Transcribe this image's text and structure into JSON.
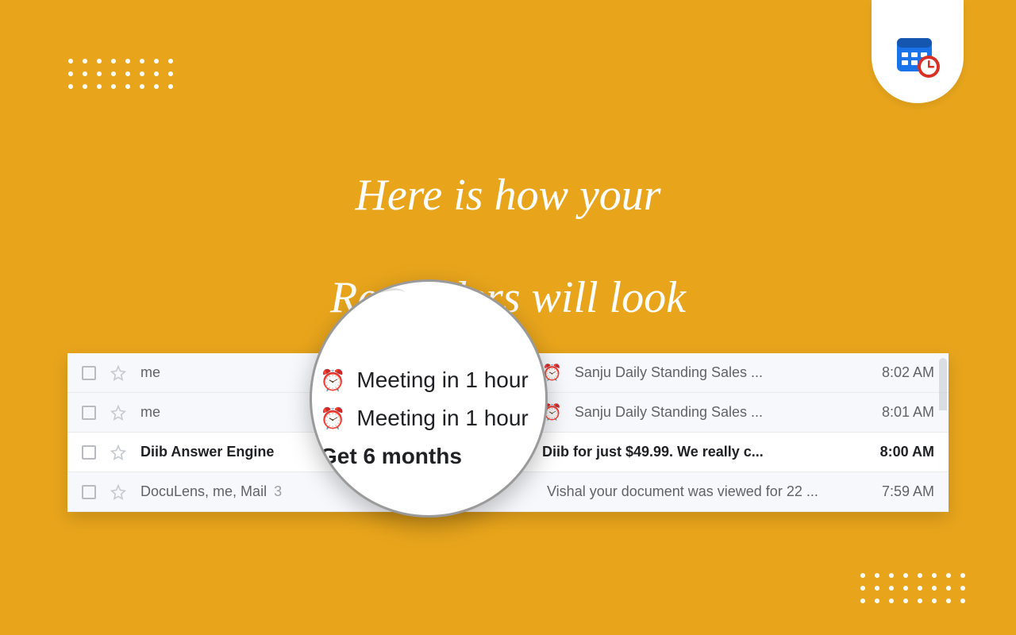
{
  "headline": {
    "line1": "Here is how your",
    "line2": "Reminders will look"
  },
  "magnifier": {
    "rows": [
      {
        "icon": "⏰",
        "text": "Meeting in 1 hour"
      },
      {
        "icon": "⏰",
        "text": "Meeting in 1 hour"
      },
      {
        "icon": "",
        "text": "Get 6 months"
      }
    ]
  },
  "inbox": {
    "rows": [
      {
        "unread": false,
        "sender": "me",
        "count": "",
        "icon": "⏰",
        "subject": "",
        "preview": "Sanju Daily Standing Sales ...",
        "time": "8:02 AM"
      },
      {
        "unread": false,
        "sender": "me",
        "count": "",
        "icon": "⏰",
        "subject": "",
        "preview": "Sanju Daily Standing Sales ...",
        "time": "8:01 AM"
      },
      {
        "unread": true,
        "sender": "Diib Answer Engine",
        "count": "",
        "icon": "",
        "subject": "Diib for just $49.99. We really c...",
        "preview": "",
        "time": "8:00 AM"
      },
      {
        "unread": false,
        "sender": "DocuLens, me, Mail",
        "count": "3",
        "icon": "",
        "subject": "",
        "preview": "Vishal your document was viewed for 22 ...",
        "time": "7:59 AM"
      }
    ]
  }
}
